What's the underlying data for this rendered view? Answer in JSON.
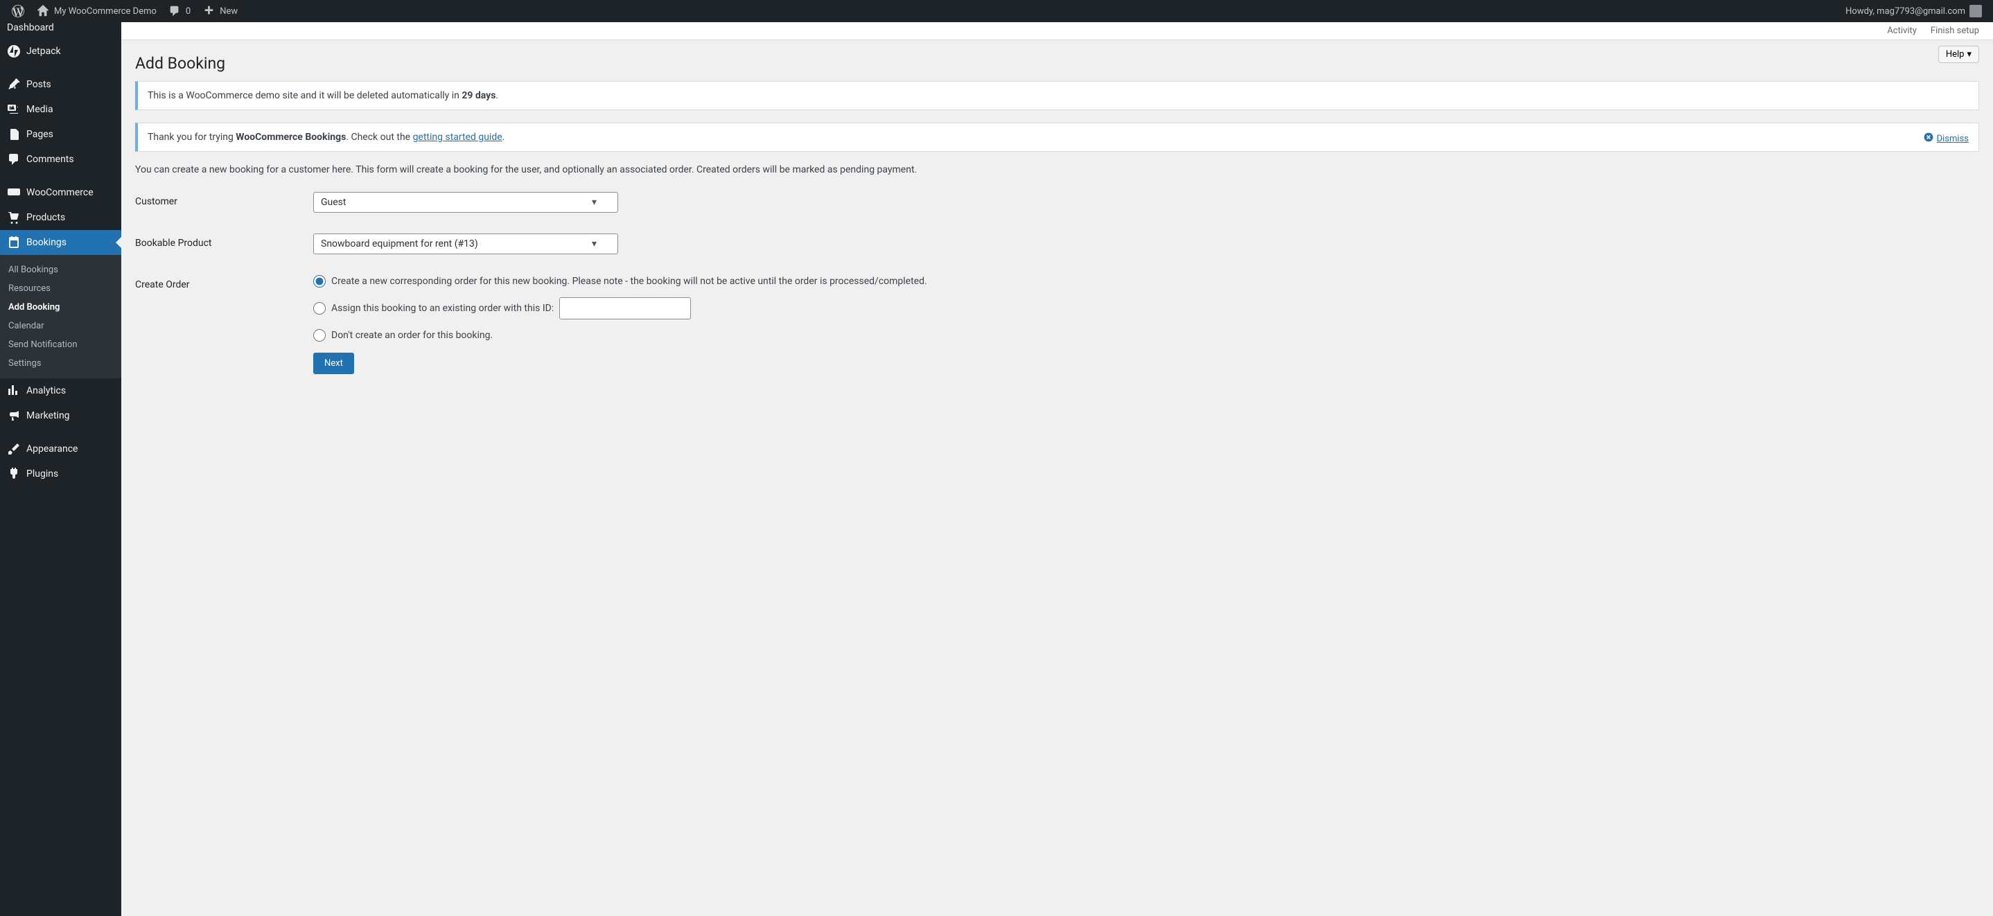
{
  "adminbar": {
    "site_name": "My WooCommerce Demo",
    "comment_count": "0",
    "new_label": "New",
    "howdy": "Howdy, mag7793@gmail.com"
  },
  "topbar": {
    "activity": "Activity",
    "finish_setup": "Finish setup"
  },
  "sidebar": {
    "dashboard": "Dashboard",
    "jetpack": "Jetpack",
    "posts": "Posts",
    "media": "Media",
    "pages": "Pages",
    "comments": "Comments",
    "woocommerce": "WooCommerce",
    "products": "Products",
    "bookings": "Bookings",
    "analytics": "Analytics",
    "marketing": "Marketing",
    "appearance": "Appearance",
    "plugins": "Plugins",
    "submenu": {
      "all_bookings": "All Bookings",
      "resources": "Resources",
      "add_booking": "Add Booking",
      "calendar": "Calendar",
      "send_notification": "Send Notification",
      "settings": "Settings"
    }
  },
  "page": {
    "help": "Help",
    "title": "Add Booking"
  },
  "notice1": {
    "text_before": "This is a WooCommerce demo site and it will be deleted automatically in ",
    "days": "29 days",
    "text_after": "."
  },
  "notice2": {
    "text_before": "Thank you for trying ",
    "bold": "WooCommerce Bookings",
    "text_mid": ". Check out the ",
    "link": "getting started guide",
    "text_after": ".",
    "dismiss": "Dismiss"
  },
  "description": "You can create a new booking for a customer here. This form will create a booking for the user, and optionally an associated order. Created orders will be marked as pending payment.",
  "form": {
    "customer_label": "Customer",
    "customer_value": "Guest",
    "product_label": "Bookable Product",
    "product_value": "Snowboard equipment for rent (#13)",
    "order_label": "Create Order",
    "radio1": "Create a new corresponding order for this new booking. Please note - the booking will not be active until the order is processed/completed.",
    "radio2": "Assign this booking to an existing order with this ID:",
    "radio3": "Don't create an order for this booking.",
    "next": "Next"
  }
}
